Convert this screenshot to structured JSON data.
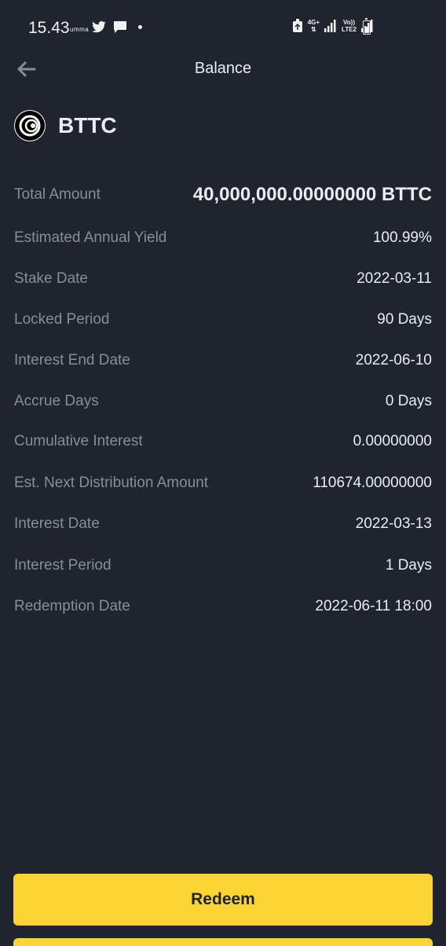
{
  "status_bar": {
    "time": "15.43",
    "carrier_mini": "umma",
    "network_top": "4G+",
    "network_label_1": "Vo))",
    "network_label_2": "LTE2"
  },
  "header": {
    "title": "Balance",
    "back_icon": "arrow-left-icon"
  },
  "asset": {
    "name": "BTTC",
    "logo_icon": "bttc-logo-icon"
  },
  "details": [
    {
      "label": "Total Amount",
      "value": "40,000,000.00000000 BTTC"
    },
    {
      "label": "Estimated Annual Yield",
      "value": "100.99%"
    },
    {
      "label": "Stake Date",
      "value": "2022-03-11"
    },
    {
      "label": "Locked Period",
      "value": "90 Days"
    },
    {
      "label": "Interest End Date",
      "value": "2022-06-10"
    },
    {
      "label": "Accrue Days",
      "value": "0 Days"
    },
    {
      "label": "Cumulative Interest",
      "value": "0.00000000"
    },
    {
      "label": "Est. Next Distribution Amount",
      "value": "110674.00000000"
    },
    {
      "label": "Interest Date",
      "value": "2022-03-13"
    },
    {
      "label": "Interest Period",
      "value": "1 Days"
    },
    {
      "label": "Redemption Date",
      "value": "2022-06-11 18:00"
    }
  ],
  "actions": {
    "redeem_label": "Redeem"
  },
  "colors": {
    "background": "#1f242e",
    "accent": "#fcd535",
    "label": "#848e9c",
    "value": "#eaecef"
  }
}
